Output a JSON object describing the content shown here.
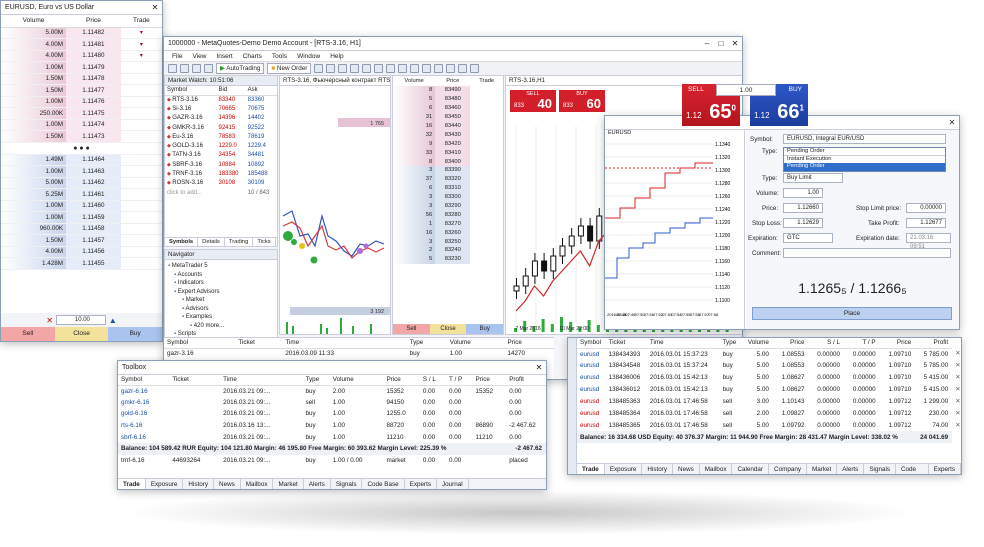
{
  "dom_window": {
    "title": "EURUSD, Euro vs US Dollar",
    "headers": [
      "Volume",
      "Price",
      "Trade"
    ],
    "asks": [
      {
        "vol": "5.00M",
        "price": "1.11482"
      },
      {
        "vol": "4.00M",
        "price": "1.11481"
      },
      {
        "vol": "4.00M",
        "price": "1.11480"
      },
      {
        "vol": "1.00M",
        "price": "1.11479"
      },
      {
        "vol": "1.50M",
        "price": "1.11478"
      },
      {
        "vol": "1.50M",
        "price": "1.11477"
      },
      {
        "vol": "1.00M",
        "price": "1.11476"
      },
      {
        "vol": "250.00K",
        "price": "1.11475"
      },
      {
        "vol": "1.00M",
        "price": "1.11474"
      },
      {
        "vol": "1.50M",
        "price": "1.11473"
      }
    ],
    "separator": "● ● ●",
    "bids": [
      {
        "vol": "1.49M",
        "price": "1.11464"
      },
      {
        "vol": "1.00M",
        "price": "1.11463"
      },
      {
        "vol": "5.00M",
        "price": "1.11462"
      },
      {
        "vol": "5.25M",
        "price": "1.11461"
      },
      {
        "vol": "1.00M",
        "price": "1.11460"
      },
      {
        "vol": "1.00M",
        "price": "1.11459"
      },
      {
        "vol": "960.00K",
        "price": "1.11458"
      },
      {
        "vol": "1.50M",
        "price": "1.11457"
      },
      {
        "vol": "4.00M",
        "price": "1.11456"
      },
      {
        "vol": "1.428M",
        "price": "1.11455"
      }
    ],
    "lot_value": "10.00",
    "sell_label": "Sell",
    "close_label": "Close",
    "buy_label": "Buy"
  },
  "main_window": {
    "title": "1000000 - MetaQuotes-Demo Demo Account - [RTS-3.16, H1]",
    "menu": [
      "File",
      "View",
      "Insert",
      "Charts",
      "Tools",
      "Window",
      "Help"
    ],
    "autotrading_label": "AutoTrading",
    "new_order_label": "New Order",
    "market_watch": {
      "title": "Market Watch: 10:51:06",
      "headers": [
        "Symbol",
        "Bid",
        "Ask"
      ],
      "rows": [
        [
          "RTS-3.16",
          "83340",
          "83360"
        ],
        [
          "Si-3.16",
          "70665",
          "70675"
        ],
        [
          "GAZR-3.16",
          "14396",
          "14402"
        ],
        [
          "GMKR-3.16",
          "92415",
          "92522"
        ],
        [
          "Eu-3.16",
          "78583",
          "78619"
        ],
        [
          "GOLD-3.16",
          "1229.0",
          "1229.4"
        ],
        [
          "TATN-3.16",
          "34354",
          "34481"
        ],
        [
          "SBRF-3.16",
          "10884",
          "10892"
        ],
        [
          "TRNF-3.16",
          "183380",
          "185488"
        ],
        [
          "ROSN-3.16",
          "30108",
          "30109"
        ]
      ],
      "add_hint": "click to add...",
      "count": "10 / 843",
      "tabs": [
        "Symbols",
        "Details",
        "Trading",
        "Ticks"
      ]
    },
    "navigator": {
      "title": "Navigator",
      "items": [
        {
          "label": "MetaTrader 5",
          "level": 0
        },
        {
          "label": "Accounts",
          "level": 1
        },
        {
          "label": "Indicators",
          "level": 1
        },
        {
          "label": "Expert Advisors",
          "level": 1
        },
        {
          "label": "Market",
          "level": 2
        },
        {
          "label": "Advisors",
          "level": 2
        },
        {
          "label": "Examples",
          "level": 2
        },
        {
          "label": "420 more...",
          "level": 3
        },
        {
          "label": "Scripts",
          "level": 1
        },
        {
          "label": "Examples",
          "level": 2
        },
        {
          "label": "93 more...",
          "level": 3
        }
      ],
      "tabs": [
        "Common",
        "Favorites"
      ]
    },
    "chart1_title": "RTS-3.16, Фьючерсный контракт RTS-3.16",
    "chart1_val": "1 765",
    "chart1_val2": "3 192",
    "dom2": {
      "headers": [
        "Volume",
        "Price",
        "Trade"
      ],
      "rows": [
        {
          "v": "8",
          "p": "83490",
          "t": "s"
        },
        {
          "v": "5",
          "p": "83480",
          "t": "s"
        },
        {
          "v": "6",
          "p": "83460",
          "t": "s"
        },
        {
          "v": "31",
          "p": "83450",
          "t": "s"
        },
        {
          "v": "16",
          "p": "83440",
          "t": "s"
        },
        {
          "v": "32",
          "p": "83430",
          "t": "s"
        },
        {
          "v": "9",
          "p": "83420",
          "t": "s"
        },
        {
          "v": "33",
          "p": "83410",
          "t": "s"
        },
        {
          "v": "8",
          "p": "83400",
          "t": "s"
        },
        {
          "v": "3",
          "p": "83390",
          "t": "b"
        },
        {
          "v": "37",
          "p": "83320",
          "t": "b"
        },
        {
          "v": "6",
          "p": "83310",
          "t": "b"
        },
        {
          "v": "3",
          "p": "83300",
          "t": "b"
        },
        {
          "v": "3",
          "p": "83290",
          "t": "b"
        },
        {
          "v": "56",
          "p": "83280",
          "t": "b"
        },
        {
          "v": "1",
          "p": "83270",
          "t": "b"
        },
        {
          "v": "16",
          "p": "83260",
          "t": "b"
        },
        {
          "v": "3",
          "p": "83250",
          "t": "b"
        },
        {
          "v": "2",
          "p": "83240",
          "t": "b"
        },
        {
          "v": "5",
          "p": "83230",
          "t": "b"
        }
      ],
      "sell": "Sell",
      "close": "Close",
      "buy": "Buy"
    },
    "chart2_title": "RTS-3.16,H1",
    "chart2_sell": {
      "label": "SELL",
      "prefix": "833",
      "big": "40"
    },
    "chart2_buy": {
      "label": "BUY",
      "prefix": "833",
      "big": "60"
    },
    "x_labels": [
      "7 Mar 2016",
      "10 Mar 22:00",
      "11 Mar 13:00",
      "14 Mar 20:00",
      "16 Mar 11:00"
    ],
    "trade": {
      "headers": [
        "Symbol",
        "Ticket",
        "Time",
        "Type",
        "Volume",
        "Price"
      ],
      "row": [
        "gazr-3.16",
        "",
        "2016.03.09 11:33",
        "buy",
        "1.00",
        "14270"
      ]
    }
  },
  "toolbox": {
    "title": "Toolbox",
    "headers": [
      "Symbol",
      "Ticket",
      "Time",
      "Type",
      "Volume",
      "Price",
      "S / L",
      "T / P",
      "Price",
      "Profit"
    ],
    "rows": [
      [
        "gazr-6.16",
        "",
        "2016.03.21 09:...",
        "buy",
        "2.00",
        "15352",
        "0.00",
        "0.00",
        "15352",
        "0.00"
      ],
      [
        "gmkr-6.16",
        "",
        "2016.03.21 09:...",
        "sell",
        "1.00",
        "94150",
        "0.00",
        "0.00",
        "",
        "0.00"
      ],
      [
        "gold-6.16",
        "",
        "2016.03.21 09:...",
        "buy",
        "1.00",
        "1255.0",
        "0.00",
        "0.00",
        "",
        "0.00"
      ],
      [
        "rts-6.16",
        "",
        "2016.03.16 13:...",
        "buy",
        "1.00",
        "88720",
        "0.00",
        "0.00",
        "86890",
        "-2 467.62"
      ],
      [
        "sbrf-6.16",
        "",
        "2016.03.21 09:...",
        "buy",
        "1.00",
        "11210",
        "0.00",
        "0.00",
        "11210",
        "0.00"
      ]
    ],
    "balance": "Balance: 104 589.42 RUR  Equity: 104 121.80  Margin: 46 195.80  Free Margin: 60 393.62  Margin Level: 225.39 %",
    "balance_profit": "-2 467.62",
    "pending": [
      "trnf-6.16",
      "44693264",
      "2016.03.21 09:...",
      "buy",
      "1.00 / 0.00",
      "market",
      "0.00",
      "0.00",
      "",
      "placed"
    ],
    "tabs": [
      "Trade",
      "Exposure",
      "History",
      "News",
      "Mailbox",
      "Market",
      "Alerts",
      "Signals",
      "Code Base",
      "Experts",
      "Journal"
    ]
  },
  "order": {
    "chart_title": "EURUSD",
    "y_labels": [
      "1.1340",
      "1.1320",
      "1.1300",
      "1.1280",
      "1.1260",
      "1.1240",
      "1.1220",
      "1.1200",
      "1.1180",
      "1.1160",
      "1.1140",
      "1.1120",
      "1.1100"
    ],
    "x_labels": [
      "2016.03.21",
      "07:48",
      "07:49",
      "07:50",
      "07:51",
      "07:52",
      "07:53",
      "07:54",
      "07:55",
      "07:56",
      "07:57",
      "07:58"
    ],
    "symbol_label": "Symbol:",
    "symbol_value": "EURUSD, Integral EUR/USD",
    "type_label": "Type:",
    "type_value": "Pending Order",
    "dropdown": [
      "Instant Execution",
      "Pending Order"
    ],
    "type2_value": "Buy Limit",
    "volume_label": "Volume:",
    "volume_value": "1.00",
    "price_label": "Price:",
    "price_value": "1.12660",
    "stop_limit_label": "Stop Limit price:",
    "stop_limit_value": "0.00000",
    "sl_label": "Stop Loss:",
    "sl_value": "1.12629",
    "tp_label": "Take Profit:",
    "tp_value": "1.12677",
    "expiration_label": "Expiration:",
    "expiration_value": "GTC",
    "expdate_label": "Expiration date:",
    "expdate_value": "21.03.16 09:51",
    "comment_label": "Comment:",
    "price_display": "1.1265₅ / 1.1266₅",
    "place_label": "Place"
  },
  "sb_panel": {
    "sell_label": "SELL",
    "buy_label": "BUY",
    "lot": "1.00",
    "sell_prefix": "1.12",
    "sell_big": "65",
    "sell_sup": "0",
    "buy_prefix": "1.12",
    "buy_big": "66",
    "buy_sup": "1"
  },
  "positions": {
    "headers": [
      "Symbol",
      "Ticket",
      "Time",
      "Type",
      "Volume",
      "Price",
      "S / L",
      "T / P",
      "Price",
      "Profit"
    ],
    "rows": [
      [
        "eurusd",
        "138434393",
        "2016.03.01 15:37:23",
        "buy",
        "5.00",
        "1.08553",
        "0.00000",
        "0.00000",
        "1.09710",
        "5 785.00"
      ],
      [
        "eurusd",
        "138434548",
        "2016.03.01 15:37:24",
        "buy",
        "5.00",
        "1.08553",
        "0.00000",
        "0.00000",
        "1.09710",
        "5 785.00"
      ],
      [
        "eurusd",
        "138436006",
        "2016.03.01 15:42:13",
        "buy",
        "5.00",
        "1.08627",
        "0.00000",
        "0.00000",
        "1.09710",
        "5 415.00"
      ],
      [
        "eurusd",
        "138436012",
        "2016.03.01 15:42:13",
        "buy",
        "5.00",
        "1.08627",
        "0.00000",
        "0.00000",
        "1.09710",
        "5 415.00"
      ],
      [
        "eurusd",
        "138485363",
        "2016.03.01 17:46:58",
        "sell",
        "3.00",
        "1.10143",
        "0.00000",
        "0.00000",
        "1.09712",
        "1 299.00"
      ],
      [
        "eurusd",
        "138485364",
        "2016.03.01 17:46:58",
        "sell",
        "2.00",
        "1.09827",
        "0.00000",
        "0.00000",
        "1.09712",
        "230.00"
      ],
      [
        "eurusd",
        "138485365",
        "2016.03.01 17:46:58",
        "sell",
        "5.00",
        "1.09792",
        "0.00000",
        "0.00000",
        "1.09712",
        "74.00"
      ]
    ],
    "balance": "Balance: 16 334.68 USD  Equity: 40 376.37  Margin: 11 944.90  Free Margin: 28 431.47  Margin Level: 338.02 %",
    "balance_profit": "24 041.69",
    "side_label": "Toolbox",
    "tabs": [
      "Trade",
      "Exposure",
      "History",
      "News",
      "Mailbox",
      "Calendar",
      "Company",
      "Market",
      "Alerts",
      "Signals",
      "Code Base",
      "Experts"
    ]
  }
}
